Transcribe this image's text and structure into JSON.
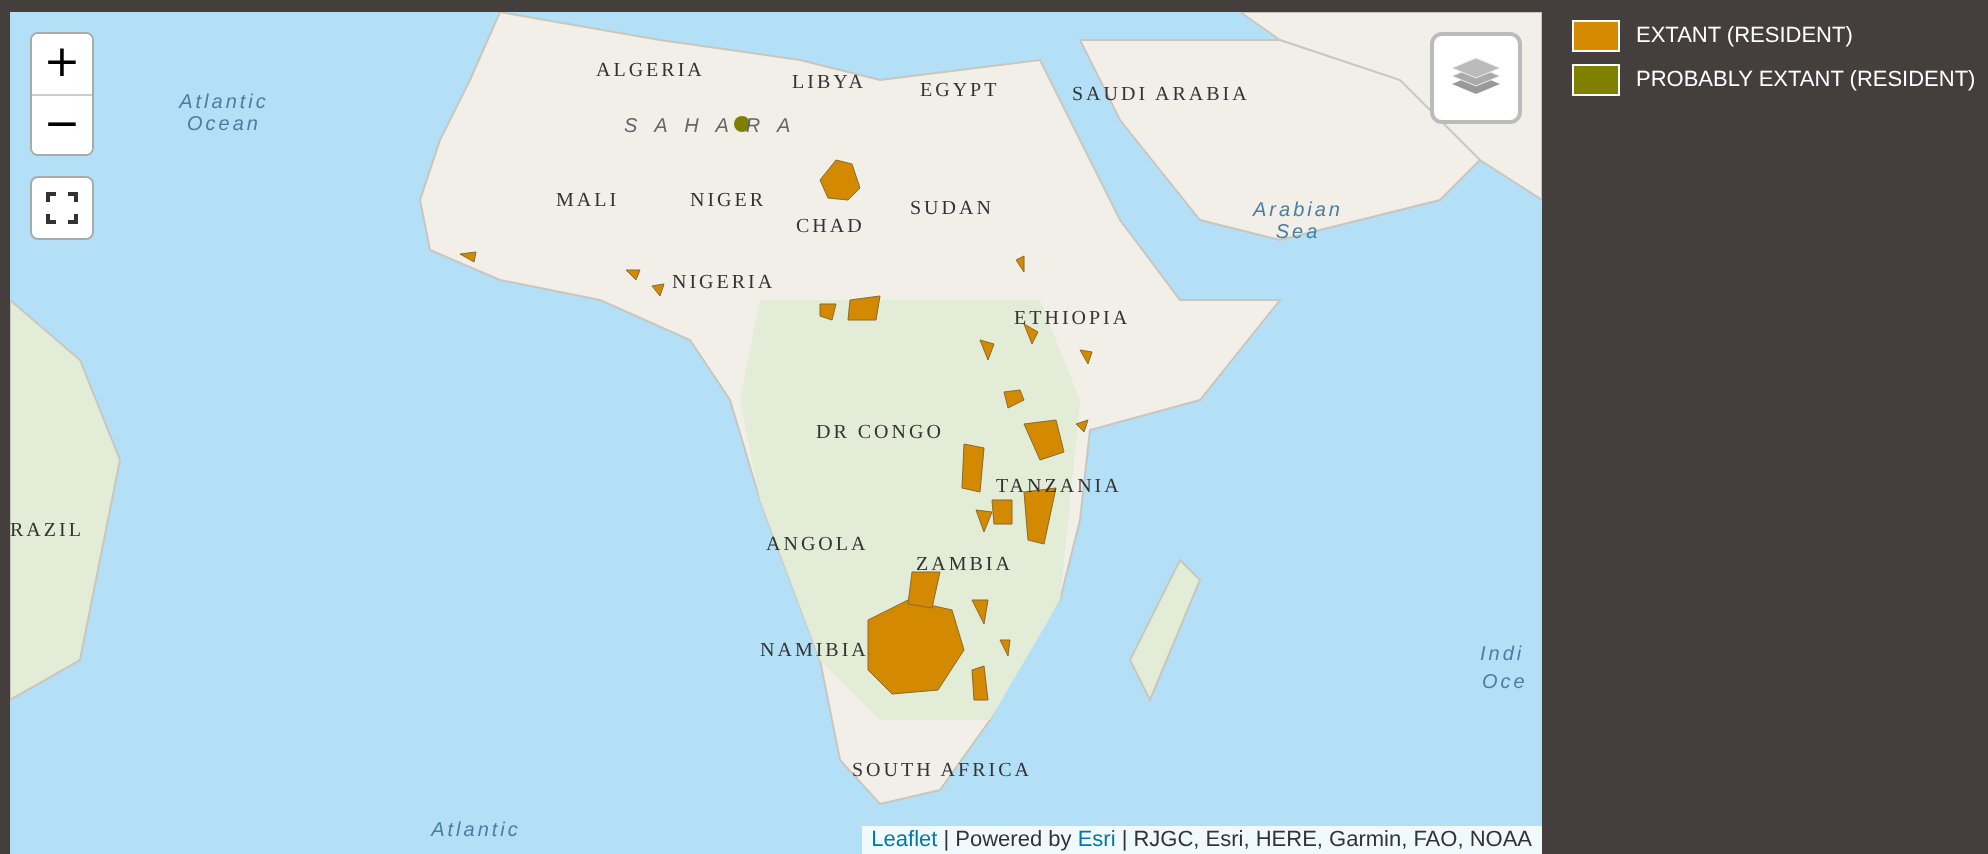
{
  "map": {
    "zoom_in": "+",
    "zoom_out": "−",
    "labels": [
      {
        "text": "Atlantic Ocean",
        "kind": "water"
      },
      {
        "text": "ALGERIA",
        "kind": "country"
      },
      {
        "text": "LIBYA",
        "kind": "country"
      },
      {
        "text": "EGYPT",
        "kind": "country"
      },
      {
        "text": "SAUDI ARABIA",
        "kind": "country"
      },
      {
        "text": "S A H A R A",
        "kind": "region"
      },
      {
        "text": "MALI",
        "kind": "country"
      },
      {
        "text": "NIGER",
        "kind": "country"
      },
      {
        "text": "CHAD",
        "kind": "country"
      },
      {
        "text": "SUDAN",
        "kind": "country"
      },
      {
        "text": "NIGERIA",
        "kind": "country"
      },
      {
        "text": "ETHIOPIA",
        "kind": "country"
      },
      {
        "text": "Arabian Sea",
        "kind": "water"
      },
      {
        "text": "DR CONGO",
        "kind": "country"
      },
      {
        "text": "TANZANIA",
        "kind": "country"
      },
      {
        "text": "ANGOLA",
        "kind": "country"
      },
      {
        "text": "ZAMBIA",
        "kind": "country"
      },
      {
        "text": "NAMIBIA",
        "kind": "country"
      },
      {
        "text": "SOUTH AFRICA",
        "kind": "country"
      },
      {
        "text": "RAZIL",
        "kind": "country"
      },
      {
        "text": "Indi",
        "kind": "water"
      },
      {
        "text": "Oce",
        "kind": "water"
      },
      {
        "text": "Atlantic",
        "kind": "water"
      }
    ],
    "attribution": [
      {
        "text": "Leaflet",
        "kind": "link"
      },
      {
        "text": " | Powered by ",
        "kind": "text"
      },
      {
        "text": "Esri",
        "kind": "link"
      },
      {
        "text": " | RJGC, Esri, HERE, Garmin, FAO, NOAA",
        "kind": "text"
      }
    ]
  },
  "legend": [
    {
      "label": "EXTANT (RESIDENT)",
      "color": "#d48a00"
    },
    {
      "label": "PROBABLY EXTANT (RESIDENT)",
      "color": "#7f7f00"
    }
  ]
}
